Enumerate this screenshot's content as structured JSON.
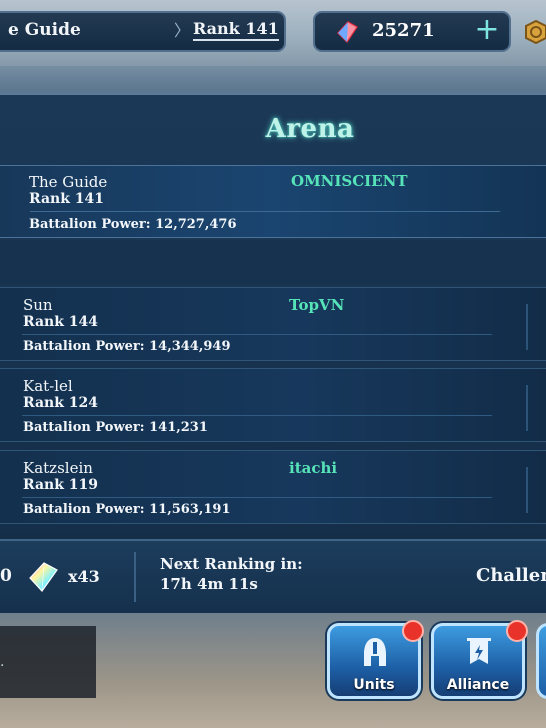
{
  "header": {
    "profile_name": "e Guide",
    "rank_label": "Rank 141",
    "gem_count": "25271"
  },
  "arena": {
    "title": "Arena",
    "self": {
      "name": "The Guide",
      "rank": "Rank 141",
      "power": "Battalion Power: 12,727,476",
      "guild": "OMNISCIENT"
    },
    "opponents": [
      {
        "name": "Sun",
        "rank": "Rank 144",
        "power": "Battalion Power: 14,344,949",
        "guild": "TopVN"
      },
      {
        "name": "Kat-lel",
        "rank": "Rank 124",
        "power": "Battalion Power: 141,231",
        "guild": ""
      },
      {
        "name": "Katzslein",
        "rank": "Rank 119",
        "power": "Battalion Power: 11,563,191",
        "guild": "itachi"
      }
    ]
  },
  "info_bar": {
    "left_count": "0",
    "prism_count": "x43",
    "next_ranking_label": "Next Ranking in:",
    "next_ranking_time": "17h 4m 11s",
    "challenge_label": "Challen"
  },
  "bottom_nav": {
    "units_label": "Units",
    "alliance_label": "Alliance"
  },
  "colors": {
    "title_glow": "#bff2e8",
    "guild_green": "#57e3b8",
    "badge_red": "#e8322a",
    "button_blue": "#1d5fa6"
  }
}
